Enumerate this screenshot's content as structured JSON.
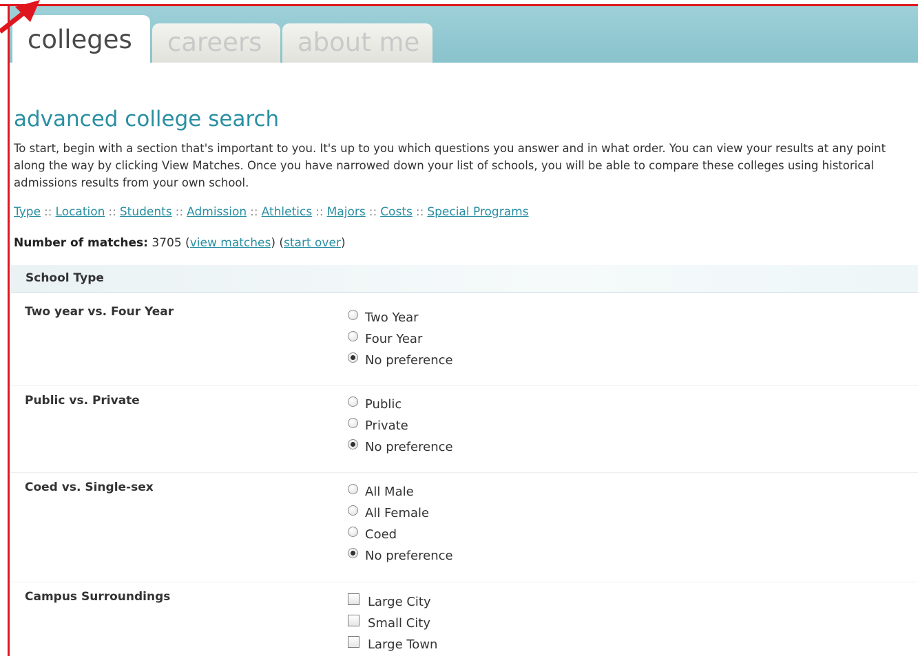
{
  "tabs": [
    {
      "label": "colleges",
      "active": true
    },
    {
      "label": "careers",
      "active": false
    },
    {
      "label": "about me",
      "active": false
    }
  ],
  "page_title": "advanced college search",
  "intro": "To start, begin with a section that's important to you. It's up to you which questions you answer and in what order. You can view your results at any point along the way by clicking View Matches. Once you have narrowed down your list of schools, you will be able to compare these colleges using historical admissions results from your own school.",
  "sections": [
    "Type",
    "Location",
    "Students",
    "Admission",
    "Athletics",
    "Majors",
    "Costs",
    "Special Programs"
  ],
  "section_separator": "::",
  "matches": {
    "label": "Number of matches:",
    "count": "3705",
    "view_link": "view matches",
    "start_over_link": "start over"
  },
  "school_type": {
    "heading": "School Type",
    "questions": [
      {
        "label": "Two year vs. Four Year",
        "type": "radio",
        "options": [
          "Two Year",
          "Four Year",
          "No preference"
        ],
        "selected": 2
      },
      {
        "label": "Public vs. Private",
        "type": "radio",
        "options": [
          "Public",
          "Private",
          "No preference"
        ],
        "selected": 2
      },
      {
        "label": "Coed vs. Single-sex",
        "type": "radio",
        "options": [
          "All Male",
          "All Female",
          "Coed",
          "No preference"
        ],
        "selected": 3
      },
      {
        "label": "Campus Surroundings",
        "type": "checkbox",
        "options": [
          "Large City",
          "Small City",
          "Large Town"
        ]
      }
    ]
  },
  "colors": {
    "accent": "#2a8fa2",
    "header_band": "#9ed0d8",
    "annotation_red": "#e0161e"
  }
}
